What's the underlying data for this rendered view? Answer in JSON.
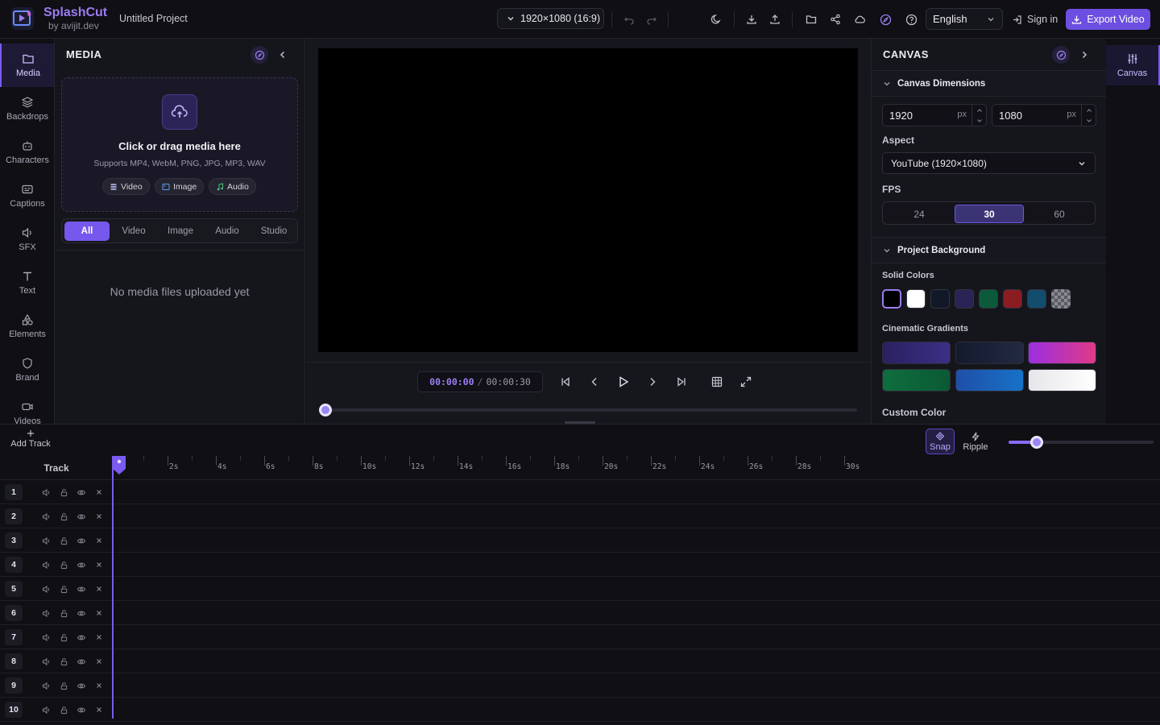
{
  "header": {
    "brand_name": "SplashCut",
    "brand_sub": "by avijit.dev",
    "project_name": "Untitled Project",
    "resolution": "1920×1080 (16:9)",
    "language": "English",
    "signin_label": "Sign in",
    "export_label": "Export Video"
  },
  "left_rail": {
    "items": [
      {
        "label": "Media",
        "icon": "folder-icon",
        "active": true
      },
      {
        "label": "Backdrops",
        "icon": "layers-icon"
      },
      {
        "label": "Characters",
        "icon": "robot-icon"
      },
      {
        "label": "Captions",
        "icon": "captions-icon"
      },
      {
        "label": "SFX",
        "icon": "speaker-icon"
      },
      {
        "label": "Text",
        "icon": "text-icon"
      },
      {
        "label": "Elements",
        "icon": "shapes-icon"
      },
      {
        "label": "Brand",
        "icon": "shield-icon"
      },
      {
        "label": "Videos",
        "icon": "video-icon"
      }
    ]
  },
  "media": {
    "title": "MEDIA",
    "drop_title": "Click or drag media here",
    "drop_sub": "Supports MP4, WebM, PNG, JPG, MP3, WAV",
    "chips": [
      "Video",
      "Image",
      "Audio"
    ],
    "tabs": [
      "All",
      "Video",
      "Image",
      "Audio",
      "Studio"
    ],
    "active_tab": "All",
    "empty_text": "No media files uploaded yet"
  },
  "player": {
    "current_time": "00:00:00",
    "separator": "/",
    "total_time": "00:00:30",
    "progress": 0
  },
  "canvas": {
    "title": "CANVAS",
    "dimensions_heading": "Canvas Dimensions",
    "width": "1920",
    "height": "1080",
    "unit": "px",
    "aspect_label": "Aspect",
    "aspect_value": "YouTube (1920×1080)",
    "fps_label": "FPS",
    "fps_options": [
      "24",
      "30",
      "60"
    ],
    "fps_selected": "30",
    "background_heading": "Project Background",
    "solid_label": "Solid Colors",
    "solid_colors": [
      "#000000",
      "#ffffff",
      "#111827",
      "#2a2356",
      "#0b5a3c",
      "#8a1c22",
      "#124d6e",
      "transparent"
    ],
    "gradient_label": "Cinematic Gradients",
    "gradients": [
      [
        "#2a2060",
        "#3b2f86"
      ],
      [
        "#141a2e",
        "#222a40"
      ],
      [
        "#9b2fe0",
        "#e03a86"
      ],
      [
        "#0e6e3e",
        "#0b5a34"
      ],
      [
        "#1f4fa8",
        "#1672c8"
      ],
      [
        "#e6e6ea",
        "#ffffff"
      ]
    ],
    "custom_label": "Custom Color"
  },
  "right_rail": {
    "canvas_label": "Canvas"
  },
  "timeline": {
    "add_track_label": "Add Track",
    "snap_label": "Snap",
    "ripple_label": "Ripple",
    "zoom_level": 0.2,
    "track_header": "Track",
    "tick_labels": [
      "2s",
      "4s",
      "6s",
      "8s",
      "10s",
      "12s",
      "14s",
      "16s",
      "18s",
      "20s",
      "22s",
      "24s",
      "26s",
      "28s",
      "30s"
    ],
    "tracks": [
      "1",
      "2",
      "3",
      "4",
      "5",
      "6",
      "7",
      "8",
      "9",
      "10"
    ]
  }
}
